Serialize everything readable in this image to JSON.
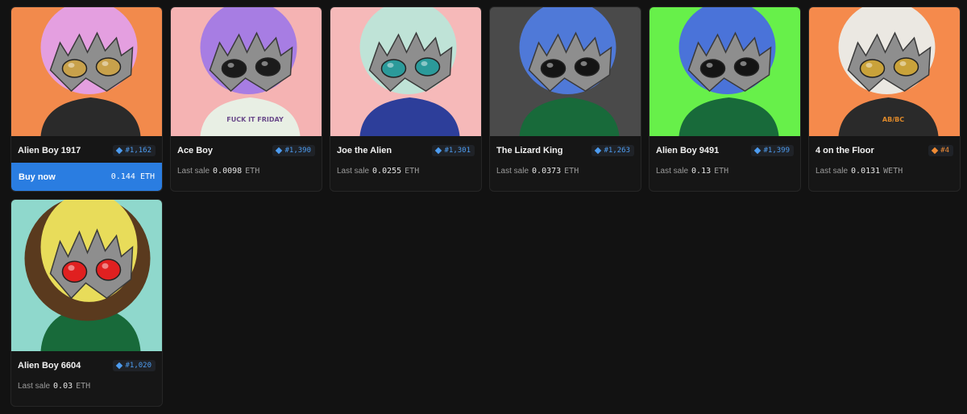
{
  "buy_now_label": "Buy now",
  "sale_prefix": "Last sale",
  "rank_color_blue": "#4d9cf0",
  "rank_color_orange": "#ef8b34",
  "cards": [
    {
      "name": "Alien Boy 1917",
      "rank": "#1,162",
      "rank_color": "#4d9cf0",
      "buy_price": "0.144",
      "buy_unit": "ETH",
      "bg": "#f28a4c",
      "head": "#e49fe0",
      "eyes": "#c8a14b",
      "body": "#2a2a2a"
    },
    {
      "name": "Ace Boy",
      "rank": "#1,390",
      "rank_color": "#4d9cf0",
      "sale_amount": "0.0098",
      "sale_unit": "ETH",
      "bg": "#f5b3b3",
      "head": "#a77de3",
      "eyes": "#1b1b1b",
      "body": "#e8efe4",
      "shirt_text": "FUCK IT FRIDAY"
    },
    {
      "name": "Joe the Alien",
      "rank": "#1,301",
      "rank_color": "#4d9cf0",
      "sale_amount": "0.0255",
      "sale_unit": "ETH",
      "bg": "#f6b9b9",
      "head": "#bfe3d7",
      "eyes": "#2b9a9a",
      "body": "#2d3e9a"
    },
    {
      "name": "The Lizard King",
      "rank": "#1,263",
      "rank_color": "#4d9cf0",
      "sale_amount": "0.0373",
      "sale_unit": "ETH",
      "bg": "#4a4a4a",
      "head": "#4f79d8",
      "eyes": "#141414",
      "body": "#186a3a"
    },
    {
      "name": "Alien Boy 9491",
      "rank": "#1,399",
      "rank_color": "#4d9cf0",
      "sale_amount": "0.13",
      "sale_unit": "ETH",
      "bg": "#67f04a",
      "head": "#4a73d9",
      "eyes": "#141414",
      "body": "#186a3a"
    },
    {
      "name": "4 on the Floor",
      "rank": "#4",
      "rank_color": "#ef8b34",
      "sale_amount": "0.0131",
      "sale_unit": "WETH",
      "bg": "#f58a4c",
      "head": "#ebe8e2",
      "eyes": "#c9a23a",
      "body": "#2a2a2a",
      "shirt_text": "AB/BC"
    },
    {
      "name": "Alien Boy 6604",
      "rank": "#1,020",
      "rank_color": "#4d9cf0",
      "sale_amount": "0.03",
      "sale_unit": "ETH",
      "bg": "#8fd8cc",
      "head": "#e8dc5a",
      "eyes": "#e02020",
      "body": "#186a3a",
      "hair": "#5a3a1e"
    }
  ]
}
